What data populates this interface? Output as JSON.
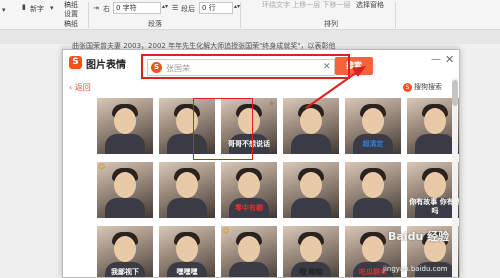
{
  "ribbon": {
    "new_char": "新字",
    "draft_line1": "稿纸",
    "draft_line2": "设置",
    "draft_group": "稿纸",
    "right_label": "右",
    "right_value": "0 字符",
    "after_label": "段后",
    "after_value": "0 行",
    "para_group": "段落",
    "faded_text": "环绕文字  上移一层  下移一层",
    "select_pane": "选择窗格",
    "arrange_group": "排列"
  },
  "document": {
    "text": "曲张国荣曾夫妻 2003，2002 年年先生化解大师追授张国荣\"终身成就奖\"，以表彰他"
  },
  "dialog": {
    "logo": "S",
    "title": "图片表情",
    "minimize": "—",
    "close": "✕",
    "search": {
      "logo": "S",
      "value": "张国荣",
      "clear": "✕",
      "button": "搜索"
    },
    "back": "返回",
    "sogou_search": "搜狗搜索",
    "tiles": [
      {
        "caption": "",
        "color": "#ffffff"
      },
      {
        "caption": "",
        "color": "#ffffff"
      },
      {
        "caption": "哥哥不想说话",
        "color": "#ffffff"
      },
      {
        "caption": "",
        "color": "#ffffff"
      },
      {
        "caption": "超清定",
        "color": "#2f7fe0"
      },
      {
        "caption": "",
        "color": "#ffffff"
      },
      {
        "caption": "",
        "color": "#ffffff"
      },
      {
        "caption": "",
        "color": "#ffffff"
      },
      {
        "caption": "零中有棚",
        "color": "#e03030"
      },
      {
        "caption": "",
        "color": "#ffffff"
      },
      {
        "caption": "",
        "color": "#ffffff"
      },
      {
        "caption": "你有故事 你有酒吗",
        "color": "#ffffff"
      },
      {
        "caption": "我鄙视下",
        "color": "#ffffff"
      },
      {
        "caption": "嘿嘿嘿",
        "color": "#ffffff"
      },
      {
        "caption": "",
        "color": "#ffffff"
      },
      {
        "caption": "哦 呦呦",
        "color": "#222222"
      },
      {
        "caption": "吃瓜群众",
        "color": "#e03030"
      },
      {
        "caption": "",
        "color": "#ffffff"
      }
    ]
  },
  "watermark": {
    "brand": "Baidu 经验",
    "url": "jingyan.baidu.com"
  }
}
